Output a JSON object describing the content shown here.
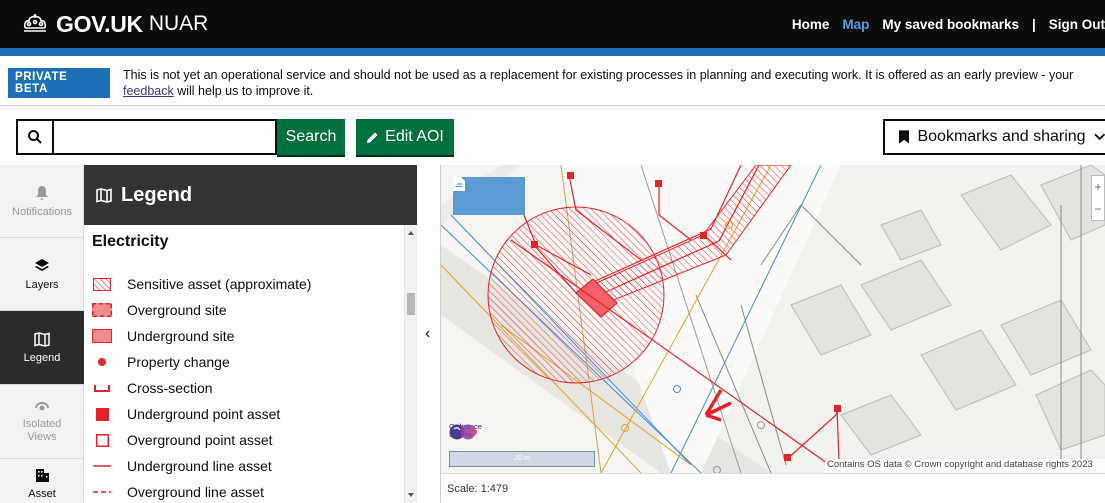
{
  "header": {
    "brand": "GOV.UK",
    "service": "NUAR",
    "nav": [
      "Home",
      "Map",
      "My saved bookmarks",
      "|",
      "Sign Out"
    ],
    "active_nav": "Map",
    "colors": {
      "header_bg": "#0b0c0c",
      "accent": "#1d70b8",
      "active_link": "#4c9fe6"
    }
  },
  "banner": {
    "tag": "PRIVATE BETA",
    "text_before": "This is not yet an operational service and should not be used as a replacement for existing processes in planning and executing work. It is offered as an early preview - your ",
    "link": "feedback",
    "text_after": " will help us to improve it."
  },
  "toolbar": {
    "search_icon": "search-icon",
    "search_value": "",
    "search_label": "Search",
    "edit_label": "Edit AOI",
    "edit_icon": "pencil-icon",
    "bookmarks_label": "Bookmarks and sharing",
    "bookmarks_icon": "bookmark-icon"
  },
  "sidebar": {
    "items": [
      {
        "label": "Notifications",
        "icon": "bell-icon",
        "state": "disabled"
      },
      {
        "label": "Layers",
        "icon": "layers-icon",
        "state": "normal"
      },
      {
        "label": "Legend",
        "icon": "map-icon",
        "state": "active"
      },
      {
        "label": "Isolated Views",
        "icon": "isolated-views-icon",
        "state": "disabled"
      },
      {
        "label": "Asset",
        "icon": "building-icon",
        "state": "normal"
      }
    ]
  },
  "legend": {
    "title": "Legend",
    "section": "Electricity",
    "items": [
      "Sensitive asset (approximate)",
      "Overground site",
      "Underground site",
      "Property change",
      "Cross-section",
      "Underground point asset",
      "Overground point asset",
      "Underground line asset",
      "Overground line asset"
    ],
    "color": "#e3242b"
  },
  "map": {
    "os_name": "Ordnance Survey",
    "scale_bar_label": "20 m",
    "copyright": "Contains OS data © Crown copyright and database rights 2023",
    "scale": "Scale: 1:479"
  }
}
